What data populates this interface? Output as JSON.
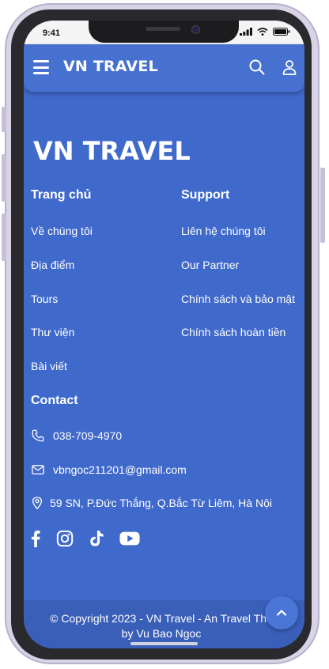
{
  "status_bar": {
    "time": "9:41"
  },
  "header": {
    "brand": "VN TRAVEL"
  },
  "footer": {
    "title": "VN TRAVEL",
    "col1": {
      "heading": "Trang chủ",
      "links": [
        "Về chúng tôi",
        "Địa điểm",
        "Tours",
        "Thư viện",
        "Bài viết"
      ]
    },
    "col2": {
      "heading": "Support",
      "links": [
        "Liên hệ chúng tôi",
        "Our Partner",
        "Chính sách và bảo mật",
        "Chính sách hoàn tiền"
      ]
    },
    "contact": {
      "heading": "Contact",
      "phone": "038-709-4970",
      "email": "vbngoc211201@gmail.com",
      "address": "59 SN, P.Đức Thắng, Q.Bắc Từ Liêm, Hà Nội"
    },
    "social_icons": [
      "facebook-icon",
      "instagram-icon",
      "tiktok-icon",
      "youtube-icon"
    ],
    "copyright_line1": "© Copyright 2023 - VN Travel - An Travel The",
    "copyright_line2": "by Vu Bao Ngoc"
  },
  "colors": {
    "primary": "#3f69cb",
    "header": "#4771d1",
    "bottom_bar": "#3a5fb9"
  }
}
